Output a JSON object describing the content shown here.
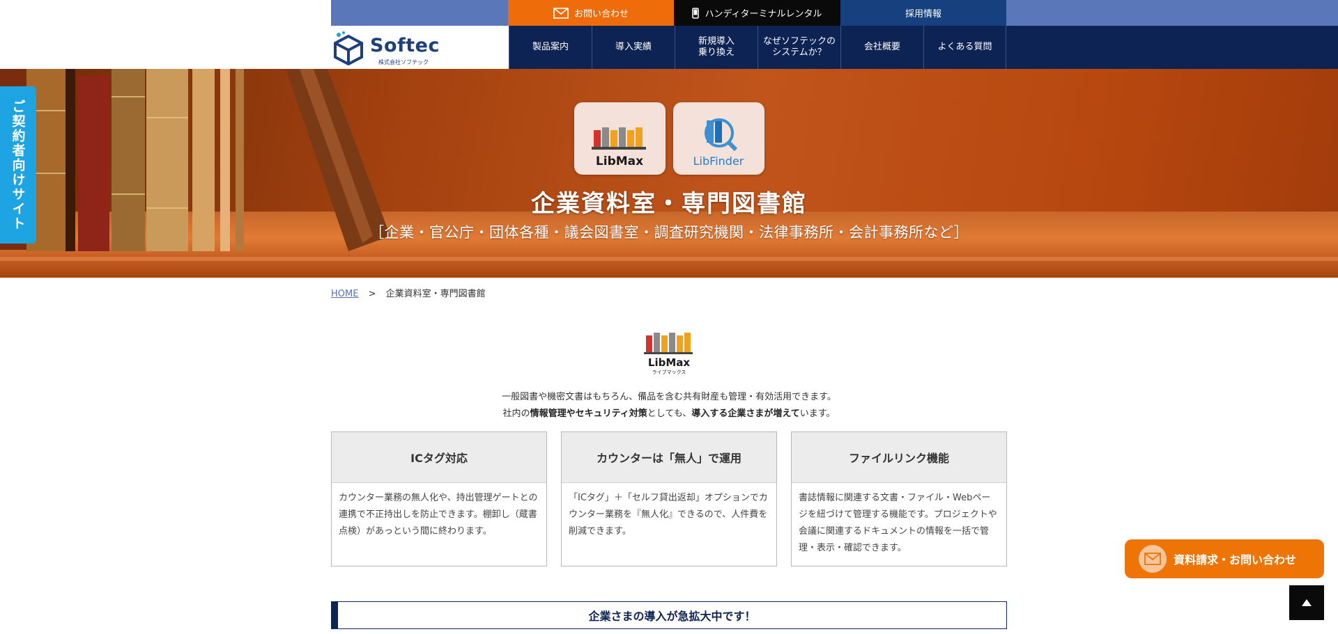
{
  "header": {
    "top_links": {
      "contact": "お問い合わせ",
      "handy": "ハンディターミナルレンタル",
      "recruit": "採用情報"
    },
    "logo": {
      "name": "Softec",
      "sub": "株式会社ソフテック"
    },
    "nav": [
      {
        "label": "製品案内"
      },
      {
        "label": "導入実績"
      },
      {
        "label": "新規導入\n乗り換え"
      },
      {
        "label": "なぜソフテックの\nシステムか？"
      },
      {
        "label": "会社概要"
      },
      {
        "label": "よくある質問"
      }
    ]
  },
  "hero": {
    "side_tab": "ご契約者向けサイト",
    "products": [
      {
        "name": "LibMax"
      },
      {
        "name": "LibFinder"
      }
    ],
    "title": "企業資料室・専門図書館",
    "subtitle": "［企業・官公庁・団体各種・議会図書室・調査研究機関・法律事務所・会計事務所など］"
  },
  "breadcrumb": {
    "home": "HOME",
    "separator": ">",
    "current": "企業資料室・専門図書館"
  },
  "intro": {
    "logo_name": "LibMax",
    "logo_sub": "ライブマックス",
    "line1": "一般図書や機密文書はもちろん、備品を含む共有財産も管理・有効活用できます。",
    "line2_pre": "社内の",
    "line2_b1": "情報管理やセキュリティ対策",
    "line2_mid": "としても、",
    "line2_b2": "導入する企業さまが増えて",
    "line2_post": "います。"
  },
  "features": [
    {
      "title": "ICタグ対応",
      "body": "カウンター業務の無人化や、持出管理ゲートとの連携で不正持出しを防止できます。棚卸し（蔵書点検）があっという間に終わります。"
    },
    {
      "title": "カウンターは「無人」で運用",
      "body": "「ICタグ」＋「セルフ貸出返却」オプションでカウンター業務を『無人化』できるので、人件費を削減できます。"
    },
    {
      "title": "ファイルリンク機能",
      "body": "書誌情報に関連する文書・ファイル・Webページを紐づけて管理する機能です。プロジェクトや会議に関連するドキュメントの情報を一括で管理・表示・確認できます。"
    }
  ],
  "banner": "企業さまの導入が急拡大中です！",
  "floating": {
    "contact": "資料請求・お問い合わせ"
  },
  "colors": {
    "navy": "#0c2354",
    "orange": "#ee6c0a",
    "sky": "#1ea4e2",
    "top_blue": "#5a78b9"
  }
}
